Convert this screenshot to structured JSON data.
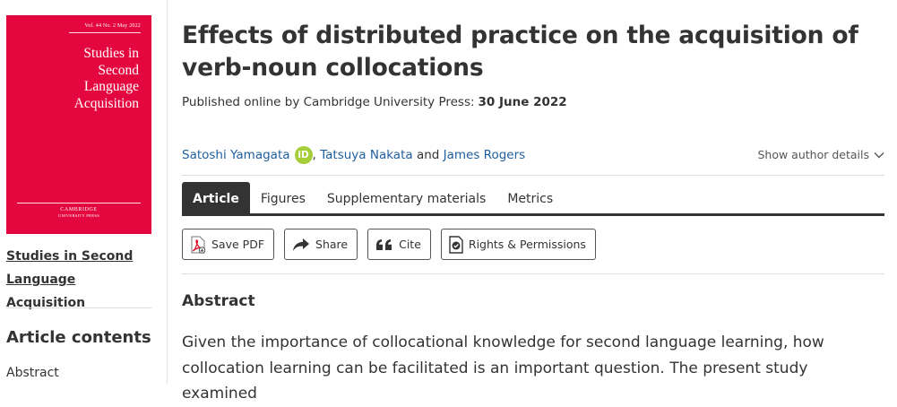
{
  "journal_cover": {
    "issue": "Vol. 44 No. 2 May 2022",
    "title_lines": [
      "Studies in",
      "Second",
      "Language",
      "Acquisition"
    ],
    "publisher_line1": "CAMBRIDGE",
    "publisher_line2": "UNIVERSITY PRESS",
    "color": "#e4063f"
  },
  "sidebar": {
    "journal_link": "Studies in Second Language Acquisition",
    "contents_heading": "Article contents",
    "contents_items": [
      "Abstract"
    ]
  },
  "article": {
    "title": "Effects of distributed practice on the acquisition of verb-noun collocations",
    "published_label": "Published online by Cambridge University Press:",
    "published_date": "30 June 2022",
    "authors": {
      "first": "Satoshi Yamagata",
      "orcid_badge": "iD",
      "separator": ",",
      "second": "Tatsuya Nakata",
      "and": "and",
      "third": "James Rogers"
    },
    "show_author_details": "Show author details",
    "tabs": [
      "Article",
      "Figures",
      "Supplementary materials",
      "Metrics"
    ],
    "active_tab": "Article",
    "actions": {
      "save_pdf": "Save PDF",
      "share": "Share",
      "cite": "Cite",
      "rights": "Rights & Permissions"
    },
    "abstract_heading": "Abstract",
    "abstract_text": "Given the importance of collocational knowledge for second language learning, how collocation learning can be facilitated is an important question. The present study examined"
  },
  "icons": {
    "orcid": "orcid-icon",
    "chevron": "chevron-down-icon",
    "pdf": "pdf-icon",
    "share": "share-arrow-icon",
    "cite": "quote-icon",
    "rights": "rights-document-icon"
  },
  "colors": {
    "link": "#1f5fa0",
    "orcid": "#a6ce39",
    "active_tab": "#333333"
  }
}
